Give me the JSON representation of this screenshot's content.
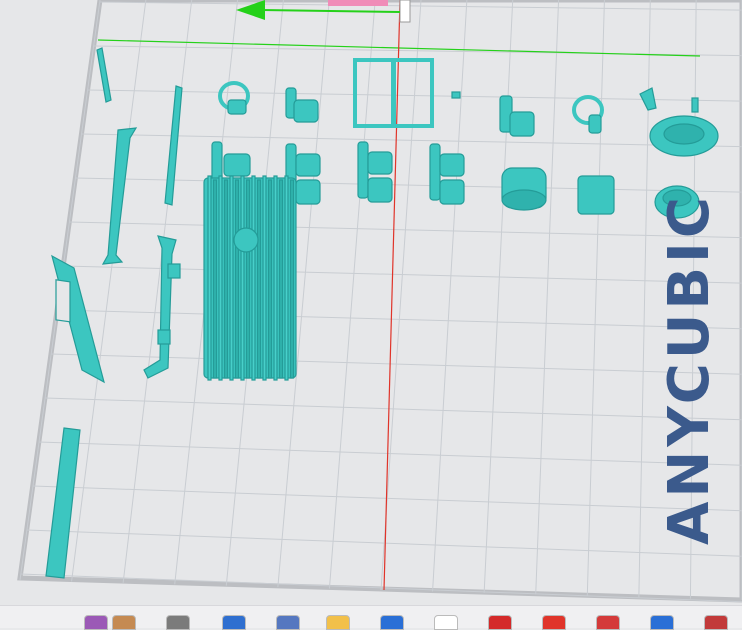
{
  "app": {
    "brand_watermark": "ANYCUBIC",
    "watermark_color": "#3b5a8c"
  },
  "colors": {
    "model": "#3cc6c0",
    "model_dark": "#249c98",
    "grid": "#c9cdd2",
    "plate": "#e6e7e9",
    "plate_border": "#bcbec2",
    "axis_x": "#25d11a",
    "axis_y": "#e0342a",
    "gizmo_pink": "#f08cb8"
  },
  "objects": [
    {
      "name": "wiper-part"
    },
    {
      "name": "bar-part-left"
    },
    {
      "name": "handrail-long"
    },
    {
      "name": "steering-wheel-1"
    },
    {
      "name": "seat-1"
    },
    {
      "name": "door-frame"
    },
    {
      "name": "small-peg"
    },
    {
      "name": "seat-2"
    },
    {
      "name": "steering-wheel-2"
    },
    {
      "name": "mirror-part"
    },
    {
      "name": "tire"
    },
    {
      "name": "seat-pair-1"
    },
    {
      "name": "seat-pair-2"
    },
    {
      "name": "seat-pair-3"
    },
    {
      "name": "seat-pair-4"
    },
    {
      "name": "drum"
    },
    {
      "name": "flat-plate"
    },
    {
      "name": "wheel-hub"
    },
    {
      "name": "bellows"
    },
    {
      "name": "handrail-curved"
    },
    {
      "name": "window-frame"
    },
    {
      "name": "vertical-bar"
    }
  ],
  "taskbar": {
    "icons": [
      {
        "name": "taskbar-app-1",
        "color": "#9b59b6"
      },
      {
        "name": "taskbar-app-2",
        "color": "#c58a52"
      },
      {
        "name": "taskbar-app-3",
        "color": "#7b7b7b"
      },
      {
        "name": "taskbar-app-4",
        "color": "#2f6fd0"
      },
      {
        "name": "taskbar-app-5",
        "color": "#5577c0"
      },
      {
        "name": "taskbar-folder",
        "color": "#f2c04a"
      },
      {
        "name": "taskbar-store",
        "color": "#2a6fd6"
      },
      {
        "name": "taskbar-file",
        "color": "#ffffff"
      },
      {
        "name": "taskbar-app-6",
        "color": "#d42a2a"
      },
      {
        "name": "taskbar-app-7",
        "color": "#e0342a"
      },
      {
        "name": "taskbar-app-8",
        "color": "#d43a3a"
      },
      {
        "name": "taskbar-app-9",
        "color": "#2a6fd6"
      },
      {
        "name": "taskbar-app-10",
        "color": "#c23a3a"
      }
    ]
  }
}
